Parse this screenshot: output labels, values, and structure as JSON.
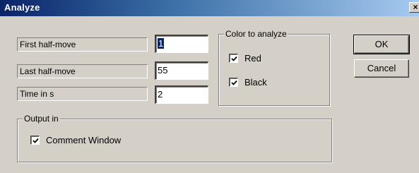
{
  "window": {
    "title": "Analyze",
    "close_glyph": "×"
  },
  "fields": {
    "first_half_move": {
      "label": "First half-move",
      "value": "1"
    },
    "last_half_move": {
      "label": "Last half-move",
      "value": "55"
    },
    "time_in_s": {
      "label": "Time in s",
      "value": "2"
    }
  },
  "color_group": {
    "title": "Color to analyze",
    "options": [
      {
        "label": "Red",
        "checked": true
      },
      {
        "label": "Black",
        "checked": true
      }
    ]
  },
  "output_group": {
    "title": "Output in",
    "options": [
      {
        "label": "Comment Window",
        "checked": true
      }
    ]
  },
  "buttons": {
    "ok": "OK",
    "cancel": "Cancel"
  },
  "colors": {
    "dialog_face": "#d4d0c8",
    "title_gradient_start": "#0a246a",
    "title_gradient_end": "#a6caf0",
    "selection": "#0a246a"
  }
}
